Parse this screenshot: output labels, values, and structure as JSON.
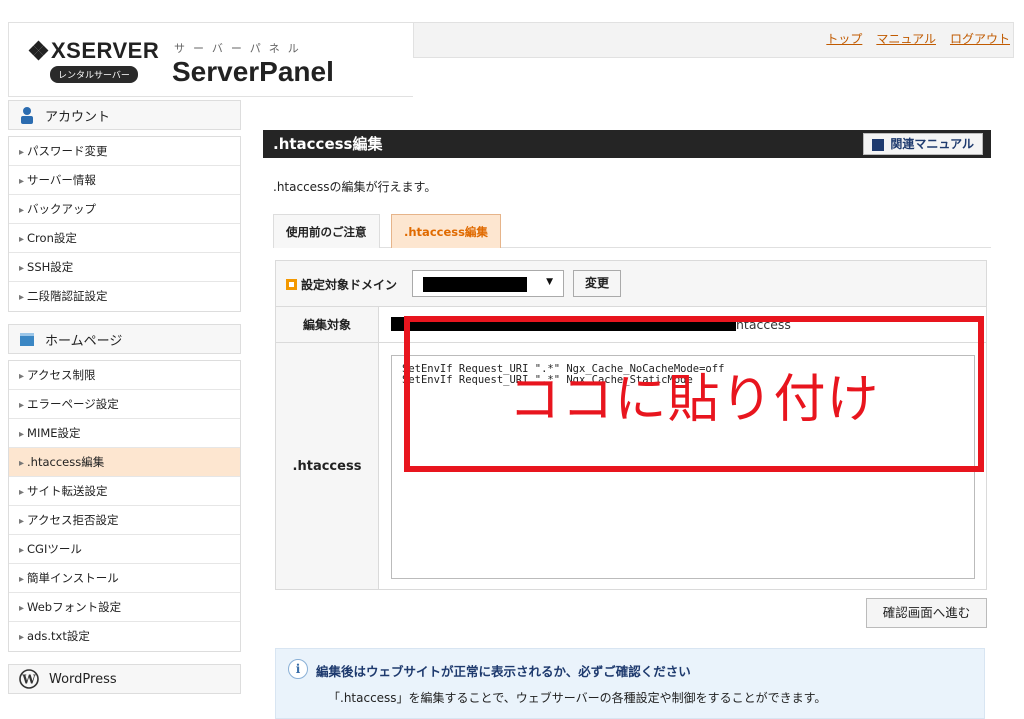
{
  "header": {
    "logo_text": "XSERVER",
    "logo_badge": "レンタルサーバー",
    "panel_subtitle": "サーバーパネル",
    "panel_title": "ServerPanel",
    "links": [
      "トップ",
      "マニュアル",
      "ログアウト"
    ]
  },
  "sidebar": {
    "account": {
      "title": "アカウント",
      "items": [
        "パスワード変更",
        "サーバー情報",
        "バックアップ",
        "Cron設定",
        "SSH設定",
        "二段階認証設定"
      ]
    },
    "homepage": {
      "title": "ホームページ",
      "items": [
        "アクセス制限",
        "エラーページ設定",
        "MIME設定",
        ".htaccess編集",
        "サイト転送設定",
        "アクセス拒否設定",
        "CGIツール",
        "簡単インストール",
        "Webフォント設定",
        "ads.txt設定"
      ],
      "active_index": 3
    },
    "wordpress": {
      "title": "WordPress"
    }
  },
  "main": {
    "title": ".htaccess編集",
    "manual_button": "関連マニュアル",
    "description": ".htaccessの編集が行えます。",
    "tabs": [
      "使用前のご注意",
      ".htaccess編集"
    ],
    "active_tab": 1,
    "domain_label": "設定対象ドメイン",
    "change_button": "変更",
    "target_label": "編集対象",
    "target_suffix": "htaccess",
    "htaccess_label": ".htaccess",
    "htaccess_content": "SetEnvIf Request_URI \".*\" Ngx_Cache_NoCacheMode=off\nSetEnvIf Request_URI \".*\" Ngx_Cache_StaticMode",
    "paste_note": "ココに貼り付け",
    "confirm_button": "確認画面へ進む",
    "info_title": "編集後はウェブサイトが正常に表示されるか、必ずご確認ください",
    "info_text": "「.htaccess」を編集することで、ウェブサーバーの各種設定や制御をすることができます。"
  },
  "colors": {
    "accent_orange": "#f39800",
    "active_bg": "#fde6d0",
    "title_bar": "#252525",
    "paste_red": "#e8151e",
    "link": "#c05a00"
  }
}
